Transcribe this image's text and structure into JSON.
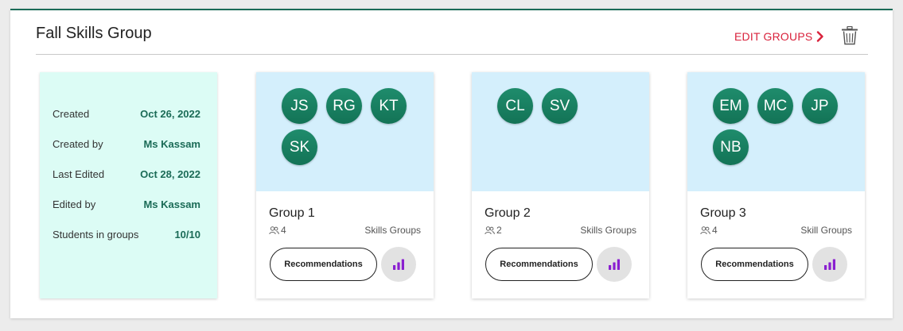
{
  "title": "Fall Skills Group",
  "edit_groups_label": "EDIT GROUPS",
  "colors": {
    "accent_red": "#d9213b",
    "brand_green": "#1b6b57",
    "avatar_green": "#1a7f62",
    "info_bg": "#dcfcf5",
    "group_bg": "#d4effc",
    "chart_purple": "#8a1fd0"
  },
  "info": {
    "rows": [
      {
        "label": "Created",
        "value": "Oct 26, 2022"
      },
      {
        "label": "Created by",
        "value": "Ms Kassam"
      },
      {
        "label": "Last Edited",
        "value": "Oct 28, 2022"
      },
      {
        "label": "Edited by",
        "value": "Ms Kassam"
      },
      {
        "label": "Students in groups",
        "value": "10/10"
      }
    ]
  },
  "groups": [
    {
      "name": "Group 1",
      "count": "4",
      "type": "Skills Groups",
      "members": [
        "JS",
        "RG",
        "KT",
        "SK"
      ],
      "rec_label": "Recommendations"
    },
    {
      "name": "Group 2",
      "count": "2",
      "type": "Skills Groups",
      "members": [
        "CL",
        "SV"
      ],
      "rec_label": "Recommendations"
    },
    {
      "name": "Group 3",
      "count": "4",
      "type": "Skill Groups",
      "members": [
        "EM",
        "MC",
        "JP",
        "NB"
      ],
      "rec_label": "Recommendations"
    }
  ],
  "icons": {
    "edit_chevron": "chevron-right-icon",
    "delete": "trash-icon",
    "members": "people-icon",
    "chart": "bar-chart-icon"
  }
}
